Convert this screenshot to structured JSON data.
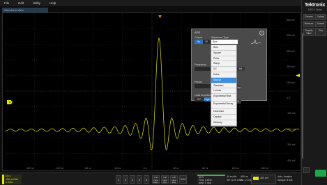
{
  "menu": [
    "File",
    "Edit",
    "Utility",
    "Help"
  ],
  "view": {
    "title": "Waveform View"
  },
  "graticule": {
    "v_labels": [
      "500 mV",
      "400 mV",
      "300 mV",
      "200 mV",
      "100 mV",
      "0 V",
      "-100 mV",
      "-200 mV",
      "-300 mV",
      "-400 mV"
    ],
    "h_labels": [
      "-160 ns",
      "-120 ns",
      "-80 ns",
      "-40 ns",
      "0 s",
      "40 ns",
      "80 ns",
      "120 ns",
      "160 ns"
    ]
  },
  "ch1_marker": "1",
  "right_panel": {
    "logo": "Tektronix",
    "model": "MSO 5 Series",
    "buttons": [
      "Cursors",
      "Callout",
      "Measure",
      "Search",
      "Results Table",
      "Plot"
    ]
  },
  "afg": {
    "title": "AFG",
    "help": "?",
    "output_label": "Output",
    "output_on": "On",
    "output_off": "Off",
    "waveform_type_label": "Waveform Type",
    "waveform_type_value": "Sinc",
    "frequency_label": "Frequency",
    "frequency_unit": "Hz",
    "period_label": "Period",
    "amplitude_unit": "Vpp",
    "load_label": "Load Impedance",
    "load_50": "50Ω",
    "load_hiz": "High Z",
    "v_unit": "V"
  },
  "waveform_types": [
    "Sine",
    "Square",
    "Pulse",
    "Ramp",
    "DC",
    "Noise",
    "Sin(x)/x",
    "Gaussian",
    "Lorentz",
    "Exponential Rise",
    "Exponential Decay",
    "Haversine",
    "Cardiac",
    "Arbitrary"
  ],
  "waveform_selected": "Sin(x)/x",
  "status": {
    "ch1": "Ch 1",
    "ch1_scale": "100 mV/div",
    "ch1_bw": "1 GHz",
    "ch_buttons": [
      "2",
      "3",
      "4",
      "5",
      "6"
    ],
    "add_buttons": [
      "Add New Math",
      "Add New Ref",
      "Add New Bus"
    ],
    "dvm": "DVM",
    "afg_line1": "AFG",
    "afg_line2": "Freq: 1 MHz",
    "afg_line3": "Amp: 1 Vpp",
    "horizontal_line1": "40 ns/div",
    "horizontal_line2": "SR: 6.25 GS/s",
    "rl_line1": "400 ns",
    "rl_line2": "RL: 2.5 kpts",
    "trigger_value": "100 mV",
    "acq_line1": "Auto, Analyze",
    "acq_line2": "Sample: 8 bits"
  }
}
